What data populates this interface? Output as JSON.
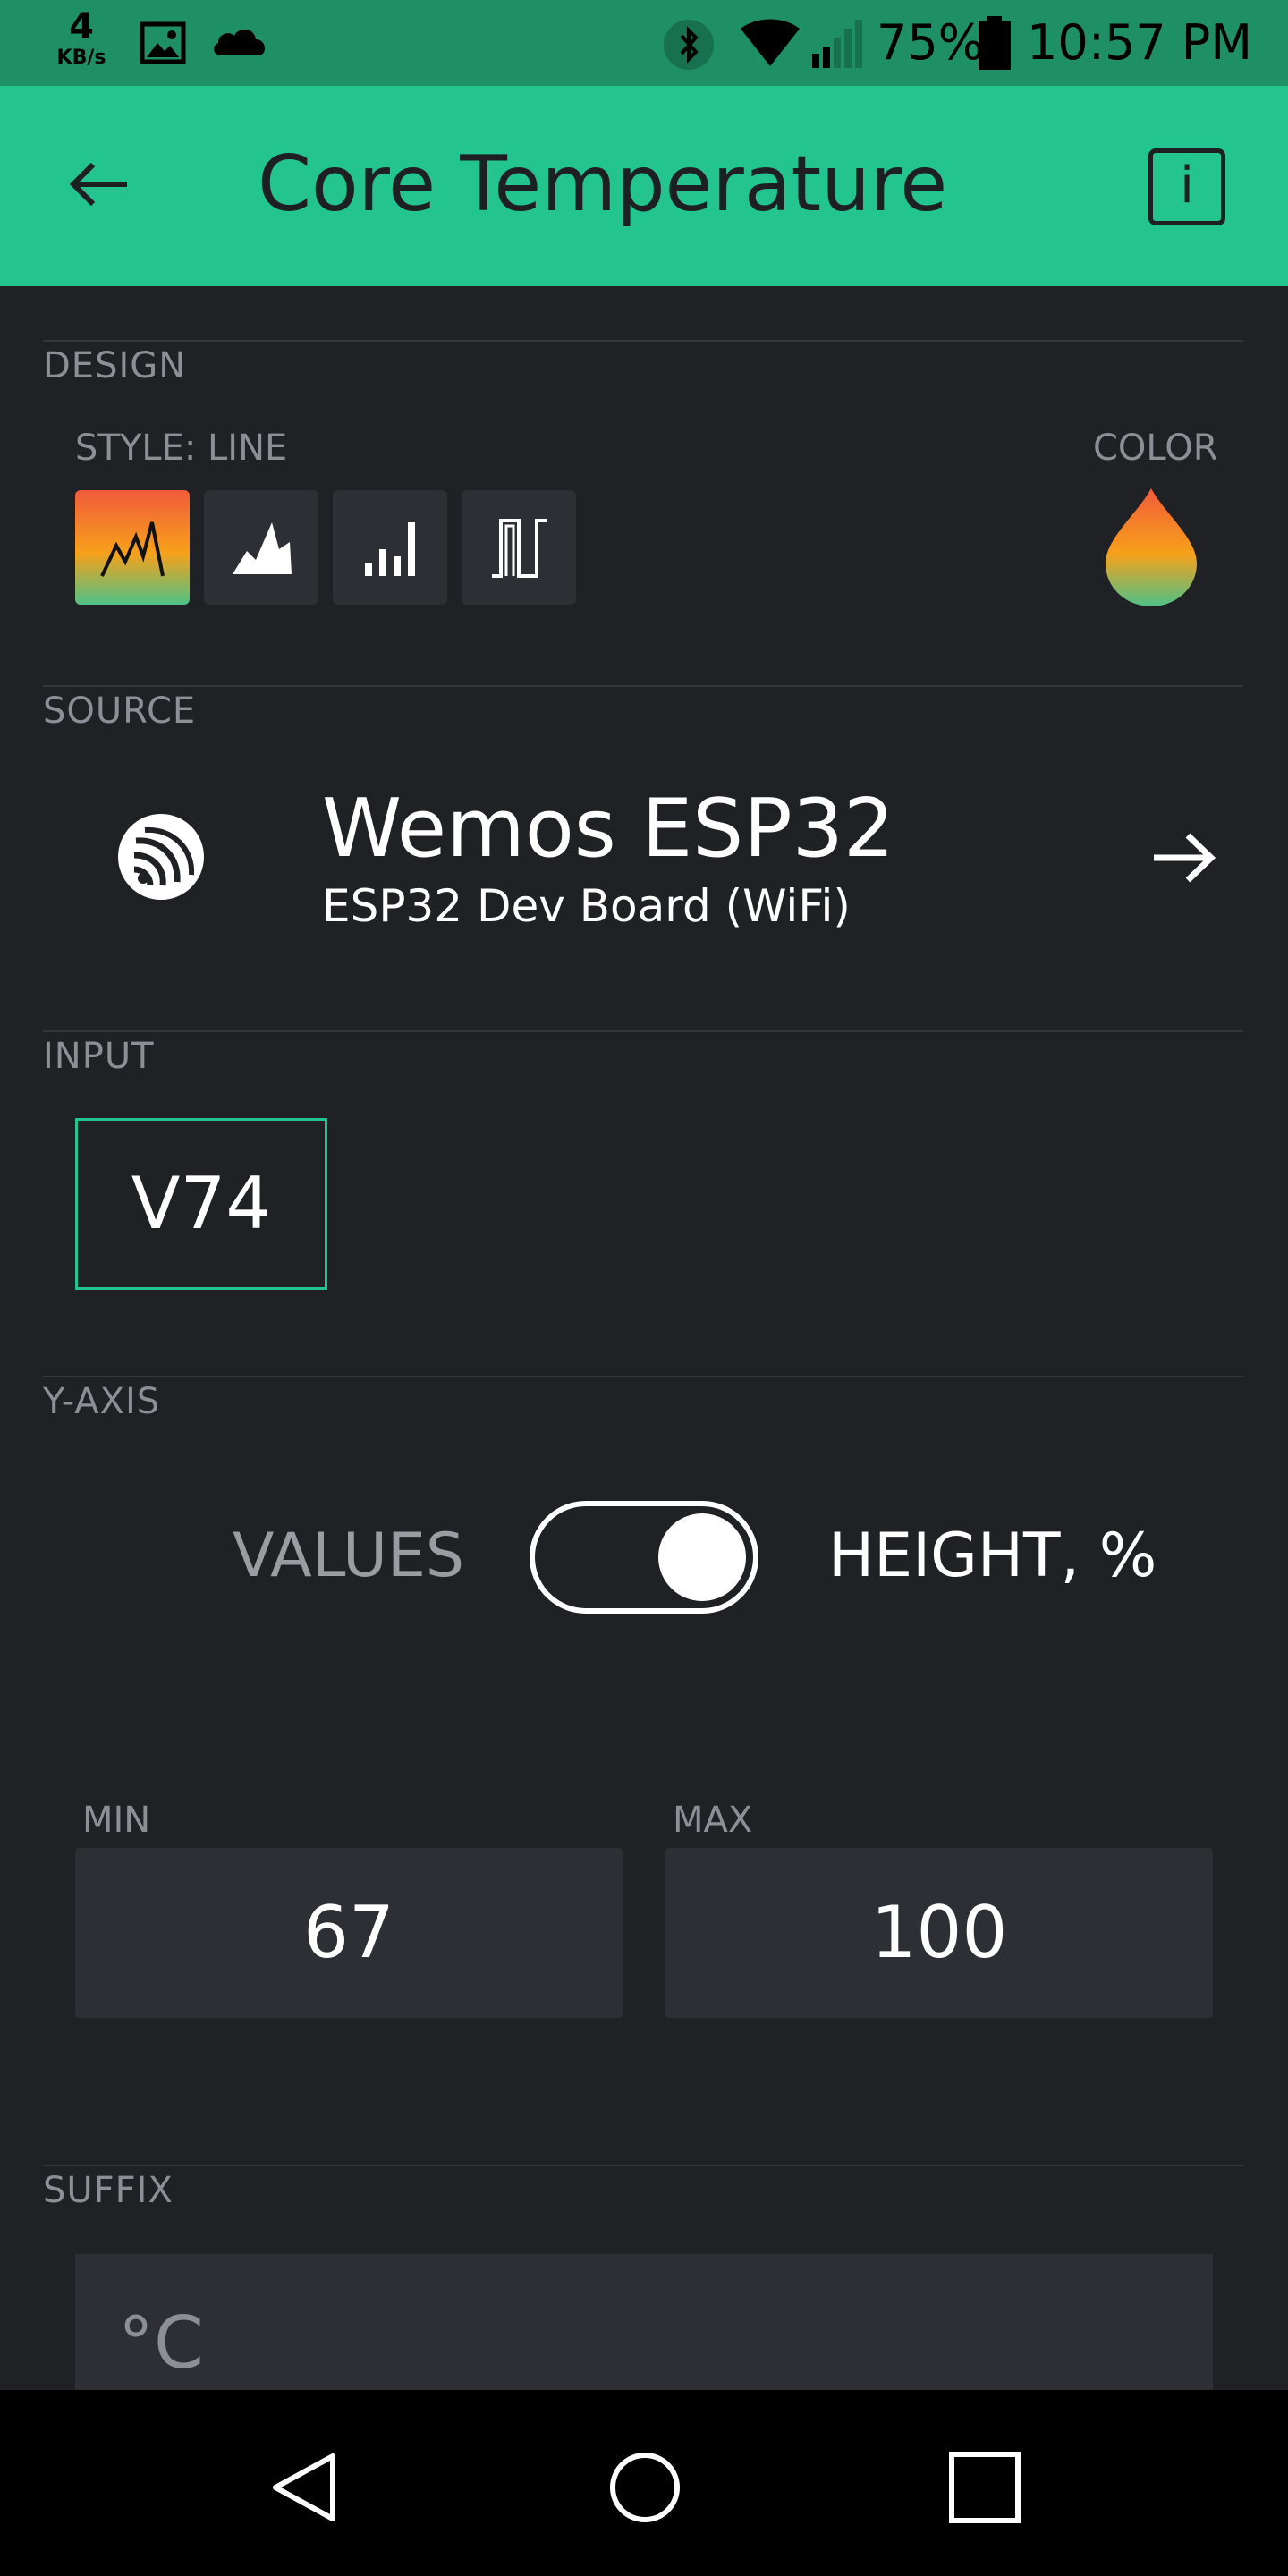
{
  "status_bar": {
    "speed_value": "4",
    "speed_unit": "KB/s",
    "battery_pct": "75%",
    "time": "10:57 PM"
  },
  "header": {
    "title": "Core Temperature",
    "info_label": "i"
  },
  "design": {
    "section_label": "DESIGN",
    "style_label": "STYLE: LINE",
    "color_label": "COLOR",
    "styles": [
      "line",
      "area",
      "bar",
      "binary"
    ],
    "selected_style": "line"
  },
  "source": {
    "section_label": "SOURCE",
    "device_name": "Wemos ESP32",
    "device_sub": "ESP32 Dev Board (WiFi)"
  },
  "input": {
    "section_label": "INPUT",
    "pin": "V74"
  },
  "y_axis": {
    "section_label": "Y-AXIS",
    "left_option": "VALUES",
    "right_option": "HEIGHT, %",
    "toggle_on": true,
    "min_label": "MIN",
    "max_label": "MAX",
    "min_value": "67",
    "max_value": "100"
  },
  "suffix": {
    "section_label": "SUFFIX",
    "value": "°C"
  },
  "colors": {
    "accent": "#23c48e",
    "background": "#202125",
    "field_bg": "#2e2f34"
  }
}
